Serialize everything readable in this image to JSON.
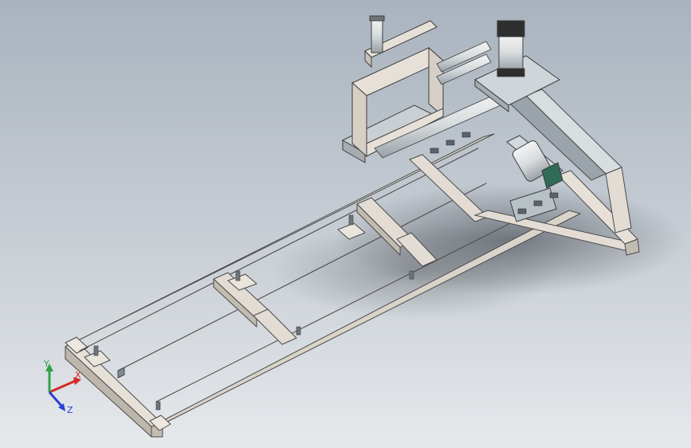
{
  "viewport": {
    "background_top": "#a9b3be",
    "background_bottom": "#e6e9ec"
  },
  "model": {
    "frame_color": "#e2dcd4",
    "frame_edge": "#4a4a4a",
    "rail_color": "#8d9aa3",
    "cylinder_color": "#2e2e2e",
    "plate_color": "#cfd5d9",
    "accent_green": "#2f6b55"
  },
  "triad": {
    "x_label": "X",
    "y_label": "Y",
    "z_label": "Z",
    "x_color": "#d42a2a",
    "y_color": "#2fa24a",
    "z_color": "#2a3fd4"
  }
}
